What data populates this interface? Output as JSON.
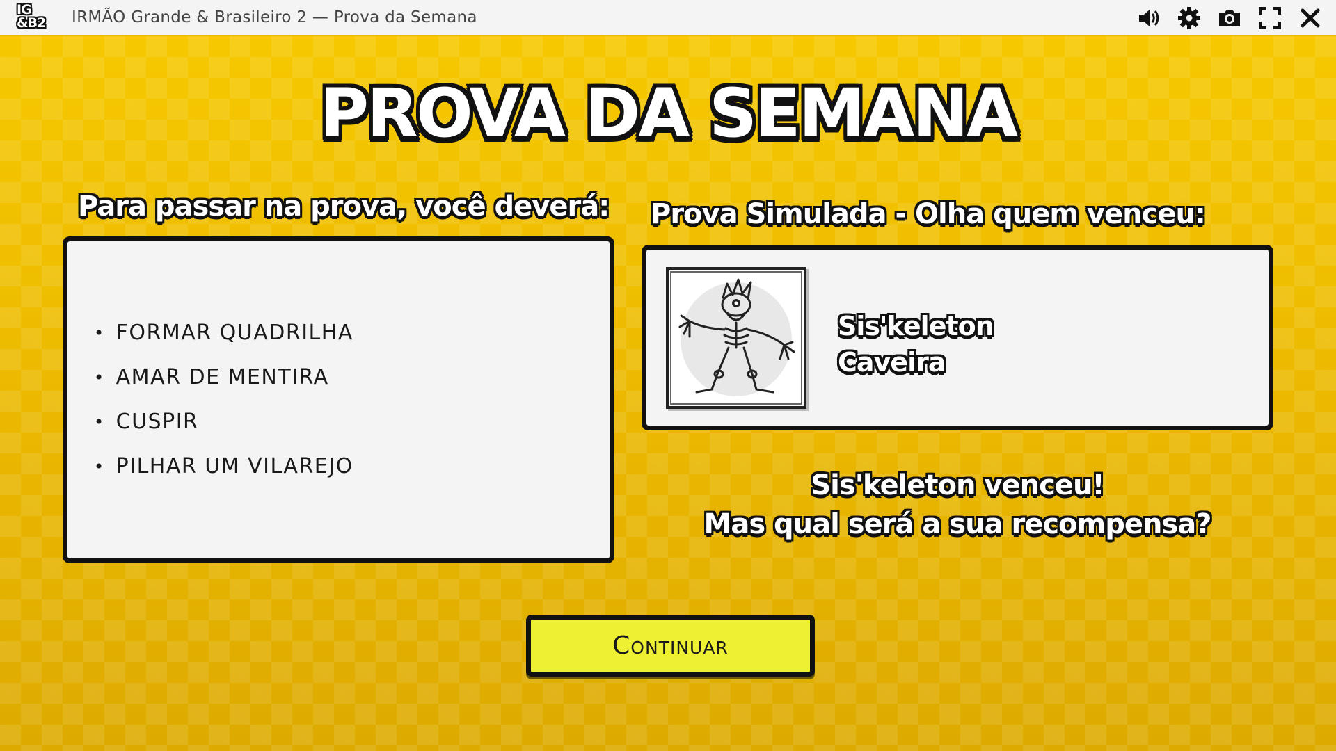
{
  "window": {
    "logo_line1": "IG",
    "logo_line2": "&B2",
    "title": "IRMÃO Grande & Brasileiro 2 — Prova da Semana",
    "icons": [
      "speaker-icon",
      "gear-icon",
      "camera-icon",
      "fullscreen-icon",
      "close-icon"
    ]
  },
  "screen": {
    "title": "PROVA DA SEMANA",
    "tasks_heading": "Para passar na prova, você deverá:",
    "tasks": [
      "FORMAR QUADRILHA",
      "AMAR DE MENTIRA",
      "CUSPIR",
      "PILHAR UM VILAREJO"
    ],
    "simulation_heading": "Prova Simulada - Olha quem venceu:",
    "winner": {
      "name": "Sis'keleton",
      "class": "Caveira"
    },
    "result_line1": "Sis'keleton venceu!",
    "result_line2": "Mas qual será a sua recompensa?",
    "continue_label": "Continuar"
  },
  "colors": {
    "background": "#f2c200",
    "panel": "#f4f4f4",
    "outline": "#111111",
    "button": "#eef033"
  }
}
